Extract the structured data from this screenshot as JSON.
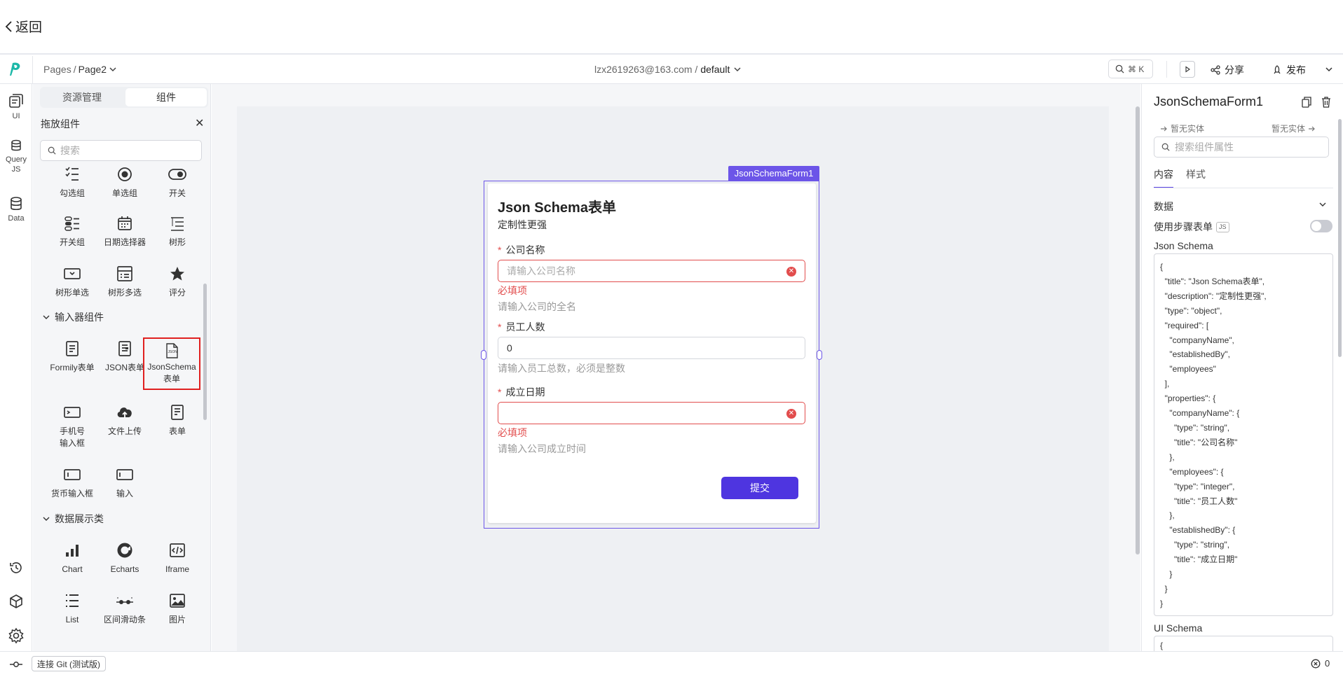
{
  "back": {
    "label": "返回"
  },
  "header": {
    "breadcrumb_root": "Pages",
    "breadcrumb_sep": "/",
    "breadcrumb_page": "Page2",
    "workspace_user": "lzx2619263@163.com /",
    "workspace_env": "default",
    "search_shortcut": "⌘ K",
    "share_label": "分享",
    "publish_label": "发布"
  },
  "rail": {
    "ui": "UI",
    "query_1": "Query",
    "query_2": "JS",
    "data": "Data"
  },
  "panel": {
    "tab_resources": "资源管理",
    "tab_components": "组件",
    "drag_title": "拖放组件",
    "search_placeholder": "搜索",
    "components_top": [
      {
        "label": "勾选组",
        "icon": "checkbox-group-icon"
      },
      {
        "label": "单选组",
        "icon": "radio-group-icon"
      },
      {
        "label": "开关",
        "icon": "switch-icon"
      },
      {
        "label": "开关组",
        "icon": "switch-group-icon"
      },
      {
        "label": "日期选择器",
        "icon": "calendar-icon"
      },
      {
        "label": "树形",
        "icon": "tree-icon"
      },
      {
        "label": "树形单选",
        "icon": "tree-select-icon"
      },
      {
        "label": "树形多选",
        "icon": "tree-multiselect-icon"
      },
      {
        "label": "评分",
        "icon": "star-icon"
      }
    ],
    "section_input": "输入器组件",
    "components_input": [
      {
        "label": "Formily表单",
        "icon": "form-icon"
      },
      {
        "label": "JSON表单",
        "icon": "json-form-icon"
      },
      {
        "label": "JsonSchema\n表单",
        "icon": "json-file-icon"
      },
      {
        "label": "手机号\n输入框",
        "icon": "phone-input-icon"
      },
      {
        "label": "文件上传",
        "icon": "upload-cloud-icon"
      },
      {
        "label": "表单",
        "icon": "form-doc-icon"
      },
      {
        "label": "货币输入框",
        "icon": "currency-input-icon"
      },
      {
        "label": "输入",
        "icon": "input-icon"
      }
    ],
    "section_display": "数据展示类",
    "components_display": [
      {
        "label": "Chart",
        "icon": "bar-chart-icon"
      },
      {
        "label": "Echarts",
        "icon": "echarts-icon"
      },
      {
        "label": "Iframe",
        "icon": "iframe-icon"
      },
      {
        "label": "List",
        "icon": "list-icon"
      },
      {
        "label": "区间滑动条",
        "icon": "range-slider-icon"
      },
      {
        "label": "图片",
        "icon": "image-icon"
      }
    ]
  },
  "form": {
    "tag": "JsonSchemaForm1",
    "title": "Json Schema表单",
    "description": "定制性更强",
    "fields": [
      {
        "label": "公司名称",
        "placeholder": "请输入公司名称",
        "value": "",
        "error": "必填项",
        "help": "请输入公司的全名"
      },
      {
        "label": "员工人数",
        "placeholder": "",
        "value": "0",
        "error": "",
        "help": "请输入员工总数，必须是整数"
      },
      {
        "label": "成立日期",
        "placeholder": "",
        "value": "",
        "error": "必填项",
        "help": "请输入公司成立时间"
      }
    ],
    "required_mark": "*",
    "submit_label": "提交"
  },
  "inspector": {
    "title": "JsonSchemaForm1",
    "entity_left": "暂无实体",
    "entity_right": "暂无实体",
    "search_placeholder": "搜索组件属性",
    "tab_content": "内容",
    "tab_style": "样式",
    "section_data": "数据",
    "step_form_label": "使用步骤表单",
    "js_badge": "JS",
    "json_schema_label": "Json Schema",
    "json_schema_text": "{\n  \"title\": \"Json Schema表单\",\n  \"description\": \"定制性更强\",\n  \"type\": \"object\",\n  \"required\": [\n    \"companyName\",\n    \"establishedBy\",\n    \"employees\"\n  ],\n  \"properties\": {\n    \"companyName\": {\n      \"type\": \"string\",\n      \"title\": \"公司名称\"\n    },\n    \"employees\": {\n      \"type\": \"integer\",\n      \"title\": \"员工人数\"\n    },\n    \"establishedBy\": {\n      \"type\": \"string\",\n      \"title\": \"成立日期\"\n    }\n  }\n}",
    "ui_schema_label": "UI Schema",
    "ui_schema_text": "{"
  },
  "footer": {
    "git_label": "连接 Git (测试版)",
    "error_count": "0"
  },
  "colors": {
    "accent": "#5b45e5",
    "selection": "#6c55e8",
    "error": "#e24d4d",
    "highlight_box": "#e02020"
  }
}
